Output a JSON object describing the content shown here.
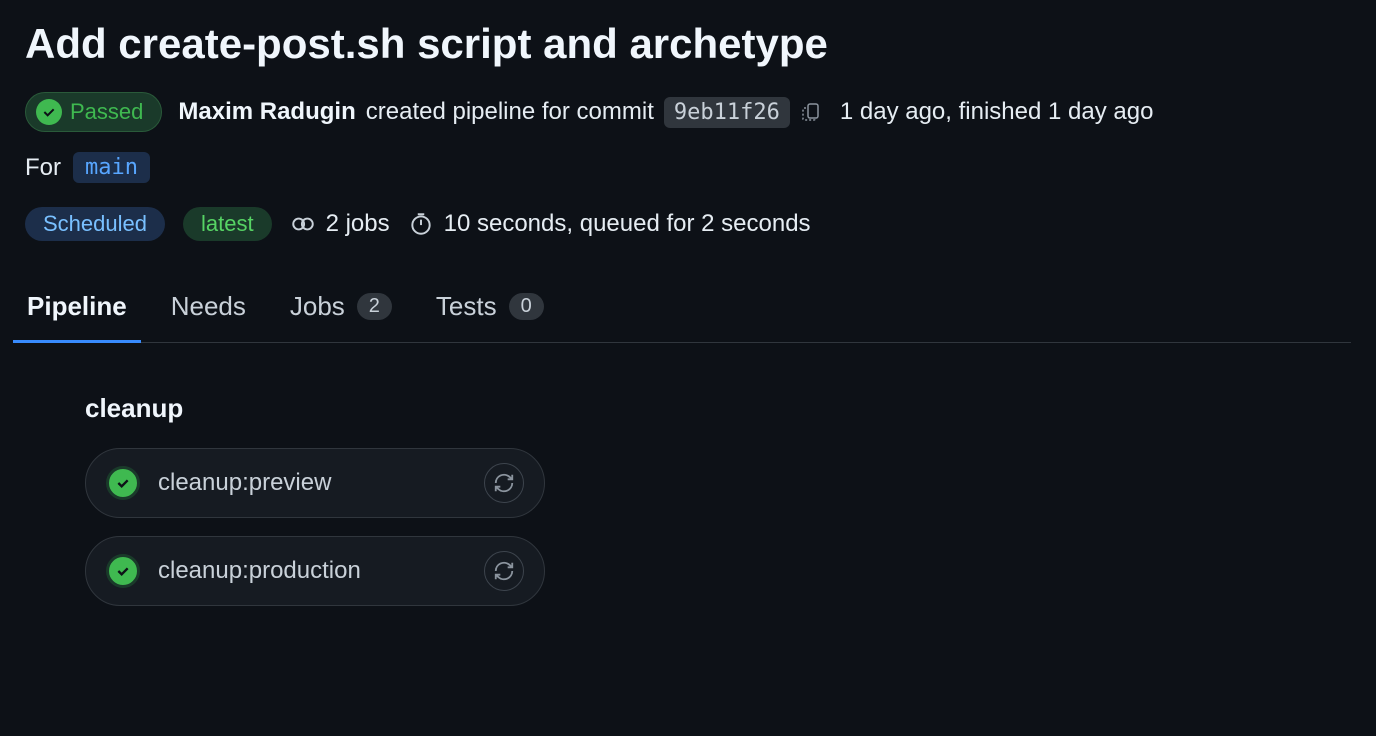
{
  "title": "Add create-post.sh script and archetype",
  "status": {
    "label": "Passed"
  },
  "author": "Maxim Radugin",
  "created_text": "created pipeline for commit",
  "commit_hash": "9eb11f26",
  "timestamp": "1 day ago, finished 1 day ago",
  "branch": {
    "for_label": "For",
    "name": "main"
  },
  "badges": {
    "scheduled": "Scheduled",
    "latest": "latest"
  },
  "jobs_summary": "2 jobs",
  "duration_summary": "10 seconds, queued for 2 seconds",
  "tabs": [
    {
      "label": "Pipeline",
      "count": null,
      "active": true
    },
    {
      "label": "Needs",
      "count": null,
      "active": false
    },
    {
      "label": "Jobs",
      "count": "2",
      "active": false
    },
    {
      "label": "Tests",
      "count": "0",
      "active": false
    }
  ],
  "stage": {
    "name": "cleanup",
    "jobs": [
      {
        "name": "cleanup:preview",
        "status": "passed"
      },
      {
        "name": "cleanup:production",
        "status": "passed"
      }
    ]
  }
}
